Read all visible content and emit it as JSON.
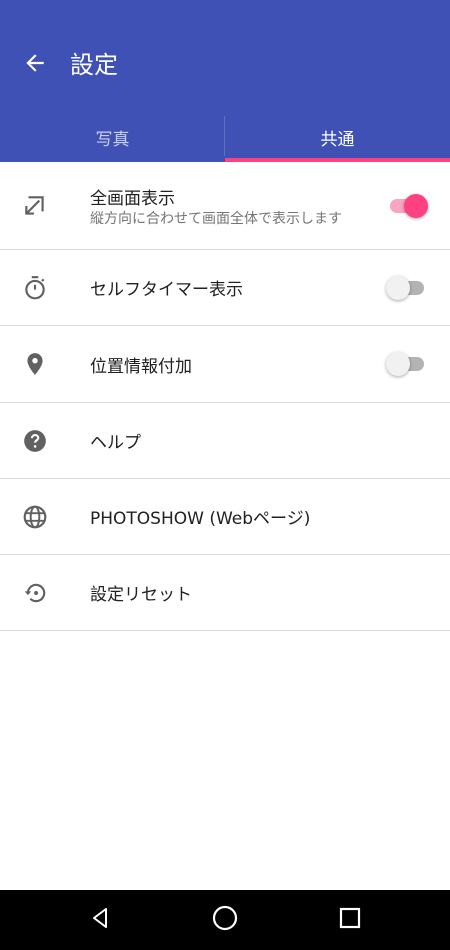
{
  "app_bar": {
    "title": "設定",
    "back_icon": "arrow-back-icon",
    "background_color": "#3f51b5",
    "accent_color": "#ff4081"
  },
  "tabs": [
    {
      "label": "写真",
      "selected": false
    },
    {
      "label": "共通",
      "selected": true
    }
  ],
  "settings": [
    {
      "icon": "fullscreen-arrow-icon",
      "label": "全画面表示",
      "sublabel": "縦方向に合わせて画面全体で表示します",
      "toggle": true
    },
    {
      "icon": "timer-icon",
      "label": "セルフタイマー表示",
      "toggle": false
    },
    {
      "icon": "location-pin-icon",
      "label": "位置情報付加",
      "toggle": false
    },
    {
      "icon": "help-icon",
      "label": "ヘルプ"
    },
    {
      "icon": "globe-icon",
      "label": "PHOTOSHOW (Webページ)"
    },
    {
      "icon": "reset-icon",
      "label": "設定リセット"
    }
  ],
  "nav_bar": {
    "buttons": [
      "back-triangle-icon",
      "home-circle-icon",
      "recents-square-icon"
    ]
  }
}
